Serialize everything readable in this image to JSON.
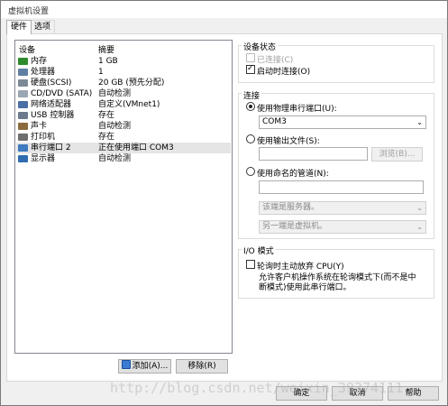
{
  "window": {
    "title": "虚拟机设置"
  },
  "tabs": [
    {
      "label": "硬件",
      "active": true
    },
    {
      "label": "选项",
      "active": false
    }
  ],
  "device_list": {
    "col_device": "设备",
    "col_summary": "摘要",
    "rows": [
      {
        "name": "内存",
        "summary": "1 GB",
        "icon": "memory-icon",
        "color": "#2e8b2e"
      },
      {
        "name": "处理器",
        "summary": "1",
        "icon": "processor-icon",
        "color": "#5f7fa3"
      },
      {
        "name": "硬盘(SCSI)",
        "summary": "20 GB (预先分配)",
        "icon": "harddisk-icon",
        "color": "#7d8a96"
      },
      {
        "name": "CD/DVD (SATA)",
        "summary": "自动检测",
        "icon": "cd-dvd-icon",
        "color": "#9aa6b2"
      },
      {
        "name": "网络适配器",
        "summary": "自定义(VMnet1)",
        "icon": "network-adapter-icon",
        "color": "#4a6fa5"
      },
      {
        "name": "USB 控制器",
        "summary": "存在",
        "icon": "usb-controller-icon",
        "color": "#6b7b8c"
      },
      {
        "name": "声卡",
        "summary": "自动检测",
        "icon": "sound-card-icon",
        "color": "#8c6b3e"
      },
      {
        "name": "打印机",
        "summary": "存在",
        "icon": "printer-icon",
        "color": "#6e6e6e"
      },
      {
        "name": "串行端口 2",
        "summary": "正在使用端口 COM3",
        "icon": "serial-port-icon",
        "color": "#3e7bbf",
        "selected": true
      },
      {
        "name": "显示器",
        "summary": "自动检测",
        "icon": "display-icon",
        "color": "#2f6cb0"
      }
    ]
  },
  "buttons": {
    "add": "添加(A)...",
    "remove": "移除(R)",
    "ok": "确定",
    "cancel": "取消",
    "help": "帮助",
    "browse": "浏览(B)..."
  },
  "device_status": {
    "title": "设备状态",
    "connected_label": "已连接(C)",
    "connected_checked": false,
    "connect_on_power_label": "启动时连接(O)",
    "connect_on_power_checked": true
  },
  "connection": {
    "title": "连接",
    "physical_port_label": "使用物理串行端口(U):",
    "physical_port_selected": true,
    "physical_port_value": "COM3",
    "output_file_label": "使用输出文件(S):",
    "output_file_value": "",
    "named_pipe_label": "使用命名的管道(N):",
    "named_pipe_value": "",
    "pipe_end_value": "该端是服务器。",
    "other_end_value": "另一端是虚拟机。"
  },
  "io_mode": {
    "title": "I/O 模式",
    "yield_cpu_label": "轮询时主动放弃 CPU(Y)",
    "yield_cpu_checked": false,
    "description": "允许客户机操作系统在轮询模式下(而不是中断模式)使用此串行端口。"
  },
  "watermark": "http://blog.csdn.net/weixin_39374111"
}
